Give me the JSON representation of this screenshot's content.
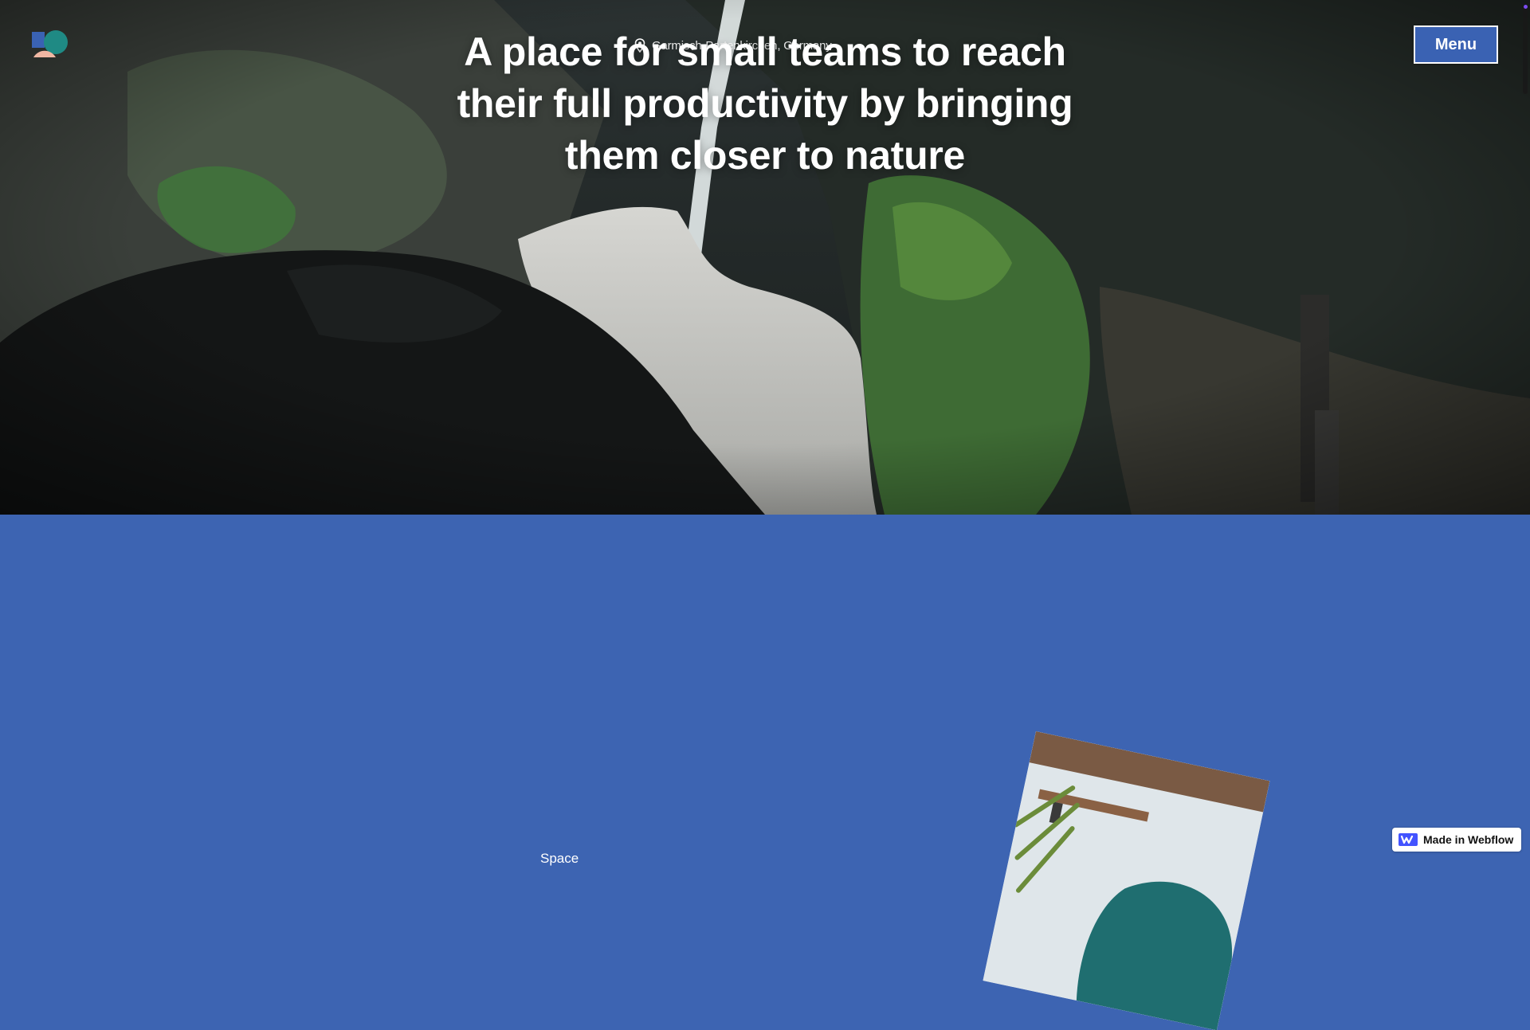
{
  "header": {
    "logo_icon": "logo-icon",
    "location_icon": "map-pin-icon",
    "location_text": "Garmisch-Partenkirchen, Germany",
    "menu_label": "Menu"
  },
  "hero": {
    "headline": "A place for small teams to reach their full productivity by bringing them closer to nature"
  },
  "section": {
    "partial_label": "Space"
  },
  "badge": {
    "icon": "webflow-icon",
    "label": "Made in Webflow"
  },
  "colors": {
    "brand_blue": "#3d64b2",
    "menu_blue": "#3a62b3",
    "text_white": "#ffffff",
    "accent_purple": "#7b4cf0"
  }
}
